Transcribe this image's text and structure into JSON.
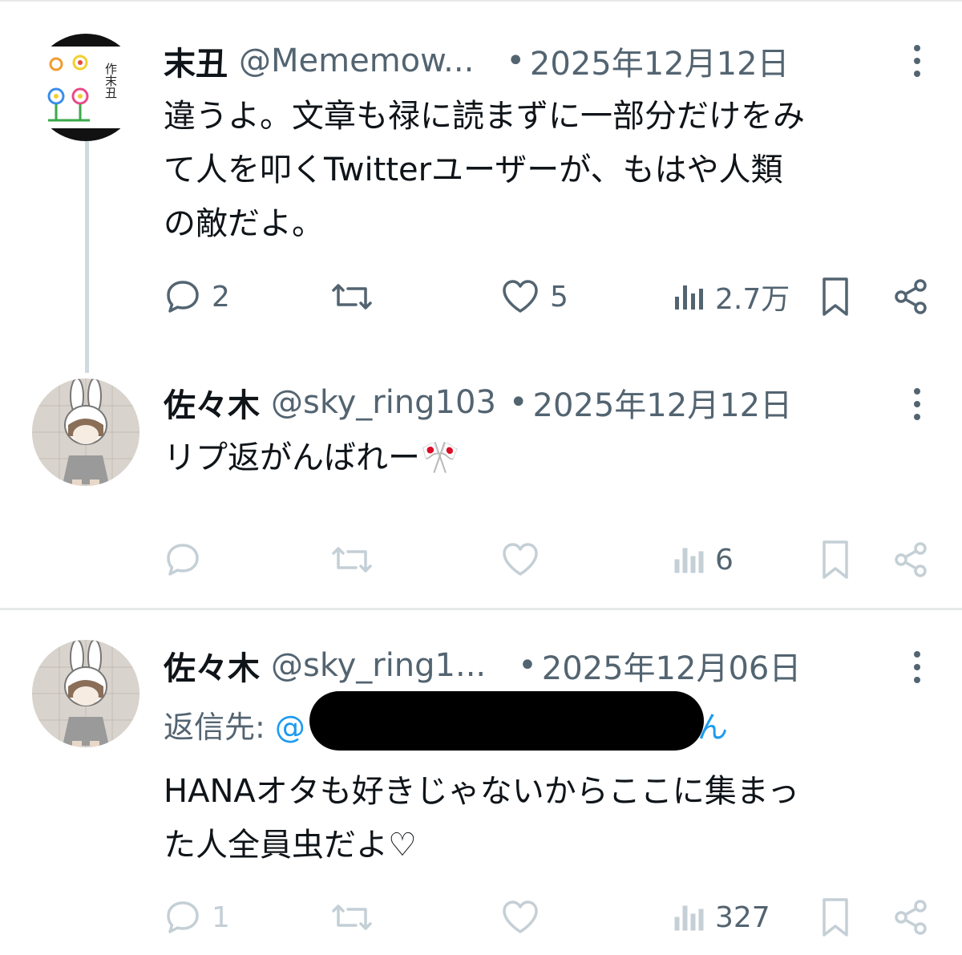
{
  "colors": {
    "text": "#0f1419",
    "muted": "#536471",
    "link": "#1d9bf0",
    "divider": "#e7e9ea"
  },
  "tweets": [
    {
      "name": "末丑",
      "handle": "@Mememow...",
      "separator": "•",
      "date": "2025年12月12日",
      "body": "違うよ。文章も禄に読まずに一部分だけをみ\nて人を叩くTwitterユーザーが、もはや人類\nの敵だよ。",
      "avatar_text": "作末丑",
      "actions": {
        "replies": "2",
        "retweets": "",
        "likes": "5",
        "views": "2.7万"
      }
    },
    {
      "name": "佐々木",
      "handle": "@sky_ring103",
      "separator": "•",
      "date": "2025年12月12日",
      "body": "リプ返がんばれー🎌",
      "actions": {
        "replies": "",
        "retweets": "",
        "likes": "",
        "views": "6"
      }
    },
    {
      "name": "佐々木",
      "handle": "@sky_ring1...",
      "separator": "•",
      "date": "2025年12月06日",
      "reply_to_label": "返信先:",
      "reply_to_mention_start": "@",
      "reply_to_mention_end": "ん",
      "body": "HANAオタも好きじゃないからここに集まっ\nた人全員虫だよ♡",
      "actions": {
        "replies": "1",
        "retweets": "",
        "likes": "",
        "views": "327"
      }
    }
  ]
}
